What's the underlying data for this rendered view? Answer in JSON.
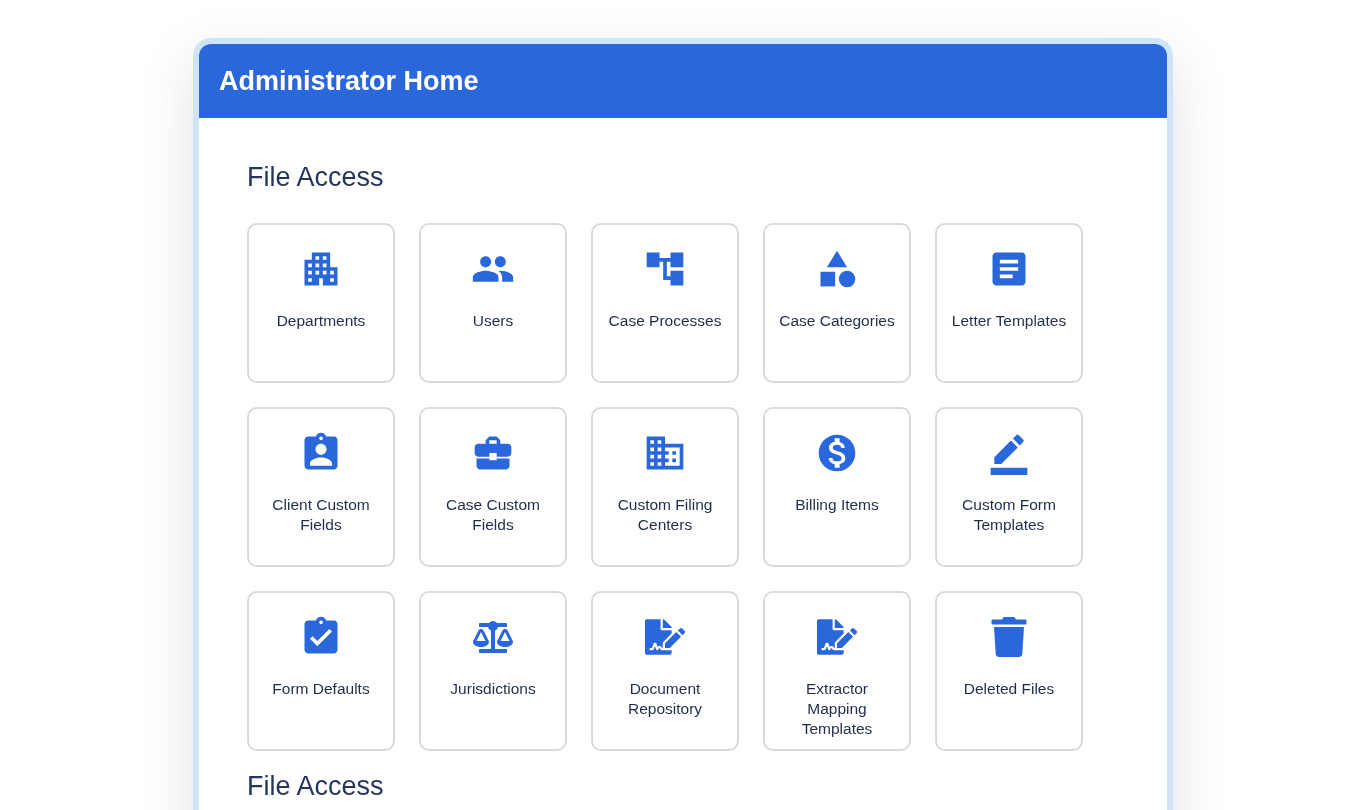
{
  "window": {
    "title": "Administrator Home"
  },
  "sections": [
    {
      "title": "File Access",
      "tiles": [
        {
          "label": "Departments",
          "kind": "building"
        },
        {
          "label": "Users",
          "kind": "people"
        },
        {
          "label": "Case Processes",
          "kind": "tree"
        },
        {
          "label": "Case Categories",
          "kind": "shapes"
        },
        {
          "label": "Letter Templates",
          "kind": "article"
        },
        {
          "label": "Client Custom Fields",
          "kind": "badge"
        },
        {
          "label": "Case Custom Fields",
          "kind": "briefcase"
        },
        {
          "label": "Custom Filing Centers",
          "kind": "city"
        },
        {
          "label": "Billing Items",
          "kind": "dollar"
        },
        {
          "label": "Custom Form Templates",
          "kind": "pen"
        },
        {
          "label": "Form Defaults",
          "kind": "clipboard"
        },
        {
          "label": "Jurisdictions",
          "kind": "scale"
        },
        {
          "label": "Document Repository",
          "kind": "signature"
        },
        {
          "label": "Extractor Mapping Templates",
          "kind": "signature"
        },
        {
          "label": "Deleted Files",
          "kind": "trash"
        }
      ]
    },
    {
      "title": "File Access"
    }
  ]
}
